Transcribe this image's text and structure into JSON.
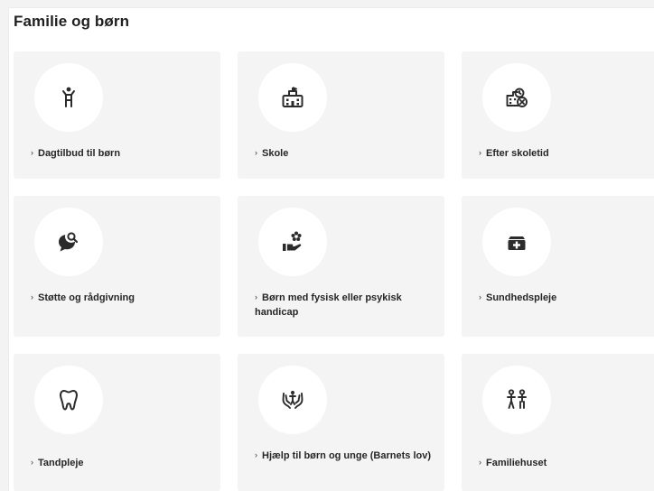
{
  "page": {
    "title": "Familie og børn"
  },
  "cards": [
    {
      "label": "Dagtilbud til børn",
      "icon": "child-icon"
    },
    {
      "label": "Skole",
      "icon": "school-icon"
    },
    {
      "label": "Efter skoletid",
      "icon": "after-school-icon"
    },
    {
      "label": "Støtte og rådgivning",
      "icon": "chat-search-icon"
    },
    {
      "label": "Børn med fysisk eller psykisk handicap",
      "icon": "hand-flower-icon"
    },
    {
      "label": "Sundhedspleje",
      "icon": "medical-kit-icon"
    },
    {
      "label": "Tandpleje",
      "icon": "tooth-icon"
    },
    {
      "label": "Hjælp til børn og unge (Barnets lov)",
      "icon": "hands-child-icon"
    },
    {
      "label": "Familiehuset",
      "icon": "family-icon"
    }
  ],
  "chevron": "›",
  "colors": {
    "card_background": "#f4f4f4",
    "icon_circle": "#ffffff",
    "text": "#262626",
    "icon": "#2b2b2b"
  }
}
